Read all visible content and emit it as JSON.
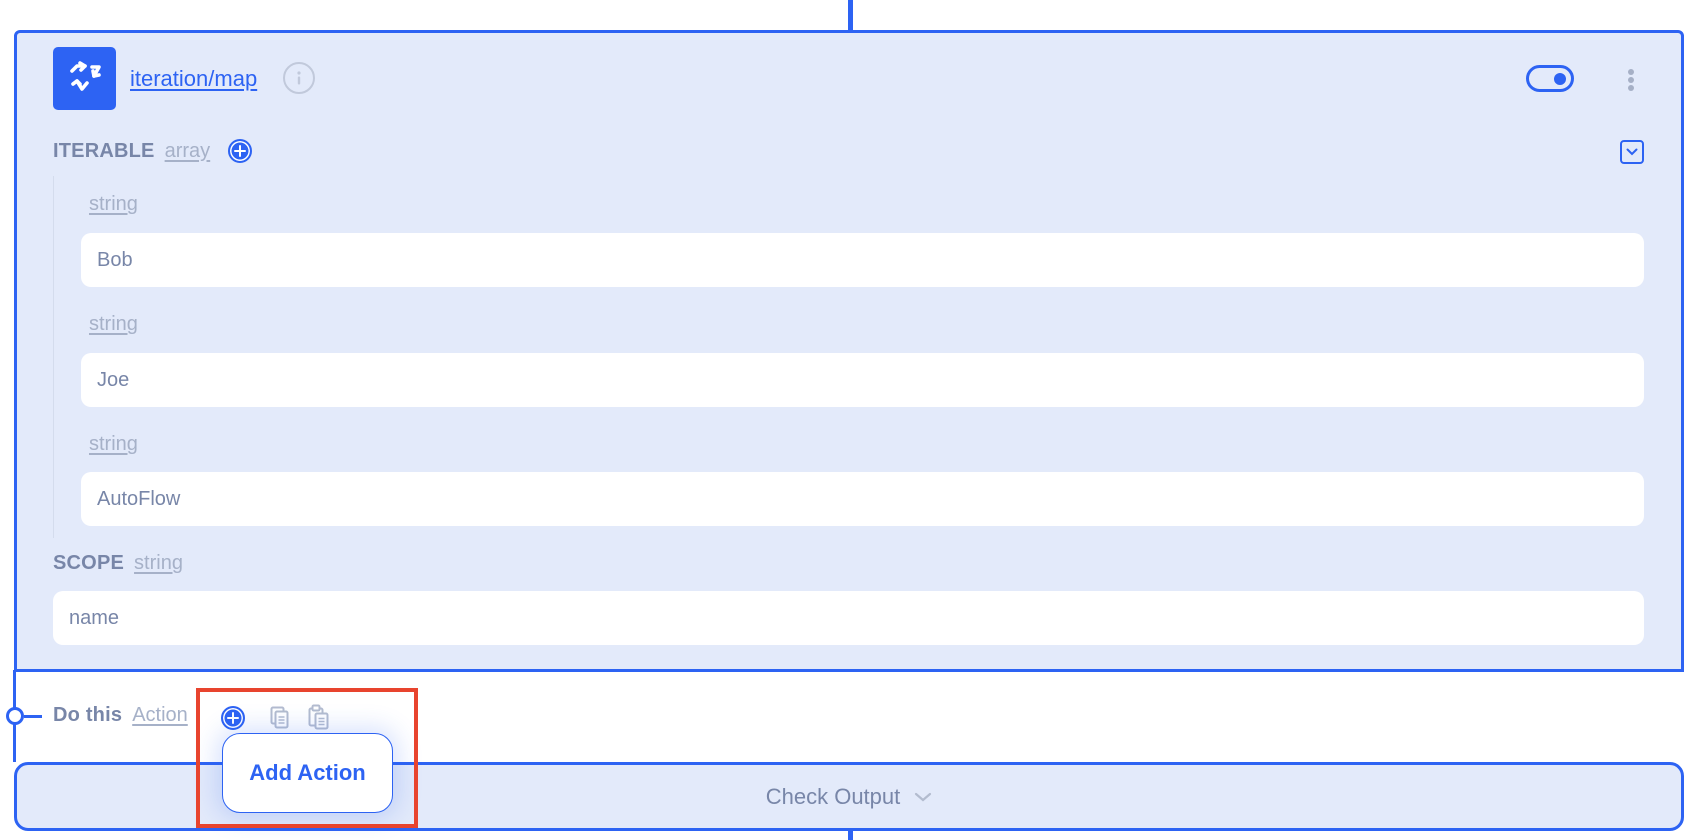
{
  "node": {
    "title": "iteration/map",
    "icon": "iteration-cycle-icon",
    "enabled": true,
    "accent_color": "#2d63f3",
    "card_background": "#e3eafa"
  },
  "fields": {
    "iterable": {
      "label": "ITERABLE",
      "type": "array",
      "items": [
        {
          "type": "string",
          "value": "Bob"
        },
        {
          "type": "string",
          "value": "Joe"
        },
        {
          "type": "string",
          "value": "AutoFlow"
        }
      ]
    },
    "scope": {
      "label": "SCOPE",
      "type": "string",
      "value": "name"
    }
  },
  "do_this": {
    "label": "Do this",
    "type": "Action",
    "tooltip": "Add Action",
    "highlight_color": "#e8442e"
  },
  "check_output": {
    "label": "Check Output"
  }
}
